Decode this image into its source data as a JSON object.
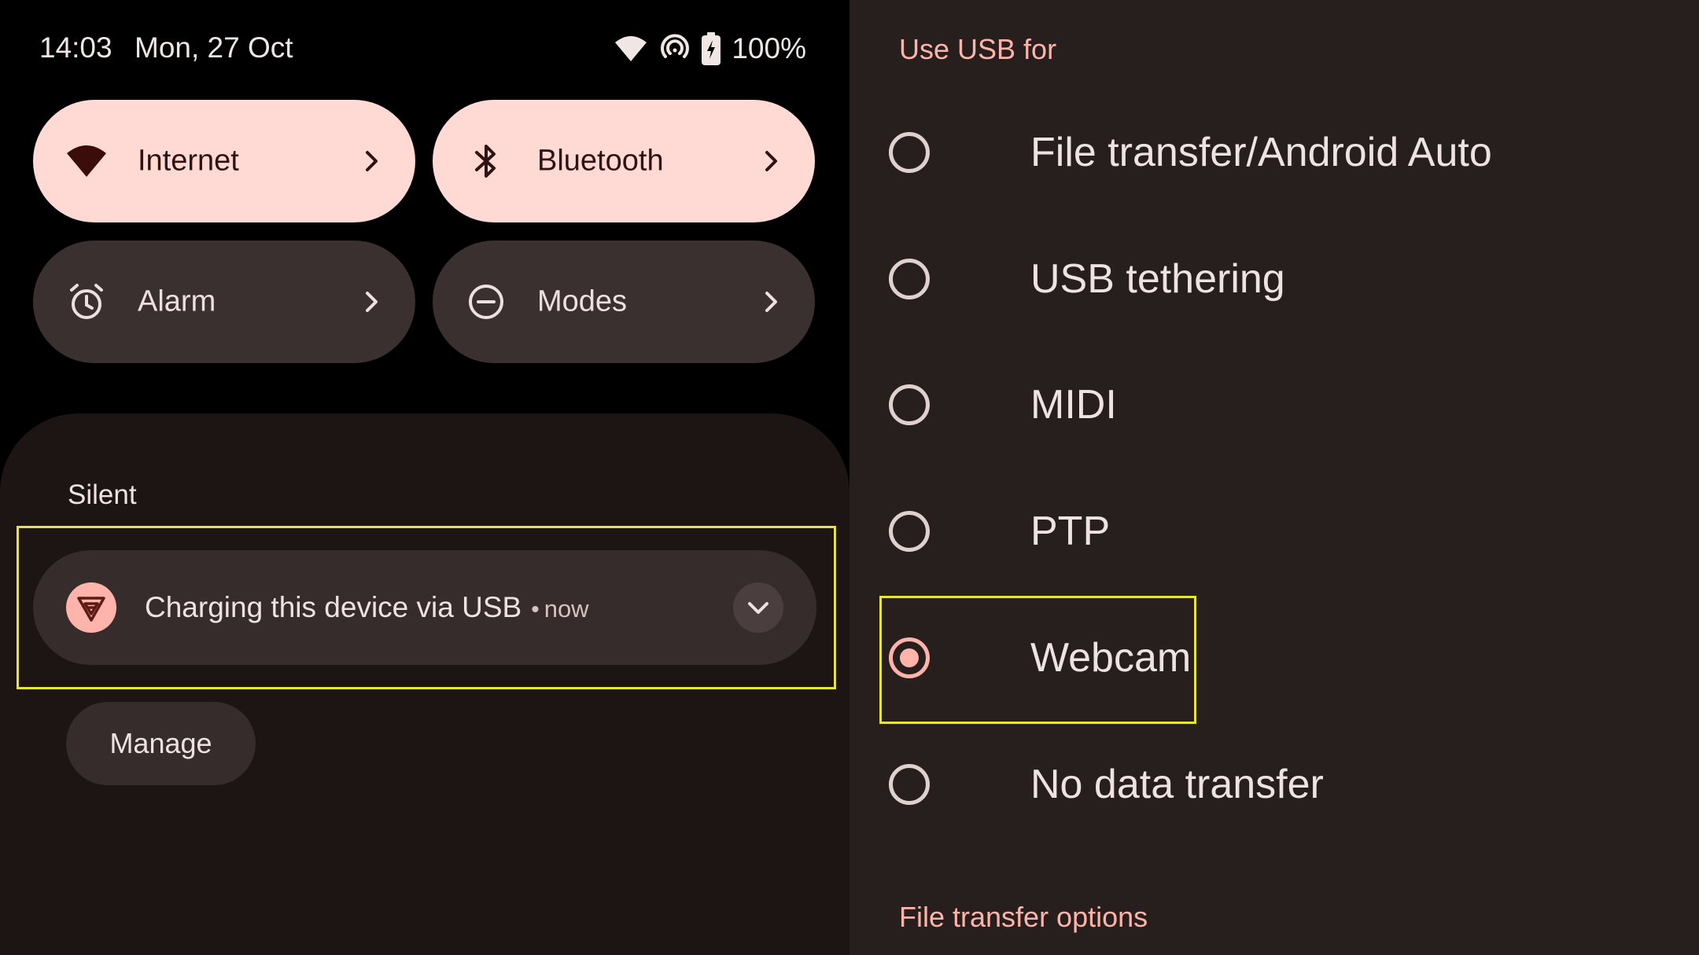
{
  "status_bar": {
    "time": "14:03",
    "date": "Mon, 27 Oct",
    "battery": "100%",
    "icons": [
      "wifi-icon",
      "hotspot-icon",
      "battery-charging-icon"
    ]
  },
  "quick_settings": {
    "tiles": [
      {
        "label": "Internet",
        "icon": "wifi-icon",
        "state": "active"
      },
      {
        "label": "Bluetooth",
        "icon": "bluetooth-icon",
        "state": "active"
      },
      {
        "label": "Alarm",
        "icon": "alarm-icon",
        "state": "inactive"
      },
      {
        "label": "Modes",
        "icon": "do-not-disturb-icon",
        "state": "inactive"
      }
    ]
  },
  "notifications": {
    "section_title": "Silent",
    "items": [
      {
        "title": "Charging this device via USB",
        "separator": "•",
        "time": "now",
        "icon": "usb-shield-icon"
      }
    ],
    "manage_label": "Manage"
  },
  "usb_settings": {
    "header": "Use USB for",
    "options": [
      {
        "label": "File transfer/Android Auto",
        "selected": false
      },
      {
        "label": "USB tethering",
        "selected": false
      },
      {
        "label": "MIDI",
        "selected": false
      },
      {
        "label": "PTP",
        "selected": false
      },
      {
        "label": "Webcam",
        "selected": true
      },
      {
        "label": "No data transfer",
        "selected": false
      }
    ],
    "footer_header": "File transfer options"
  },
  "colors": {
    "accent": "#ffb4ab",
    "tile_active_bg": "#ffd9d4",
    "tile_inactive_bg": "#3a302f",
    "panel_bg": "#261f1e",
    "highlight": "#e6e62a"
  }
}
